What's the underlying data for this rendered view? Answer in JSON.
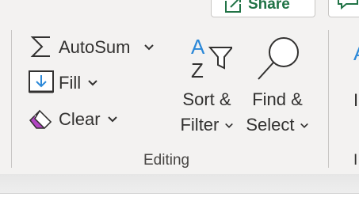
{
  "top": {
    "share_label": "Share"
  },
  "editing_group": {
    "label": "Editing",
    "autosum": {
      "label": "AutoSum",
      "icon": "sigma-icon"
    },
    "fill": {
      "label": "Fill",
      "icon": "fill-down-icon"
    },
    "clear": {
      "label": "Clear",
      "icon": "eraser-icon"
    },
    "sort_filter": {
      "line1": "Sort &",
      "line2": "Filter",
      "icon": "sort-filter-icon"
    },
    "find_select": {
      "line1": "Find &",
      "line2": "Select",
      "icon": "magnifier-icon"
    }
  },
  "next_group": {
    "partial_label_top": "I",
    "partial_label_bottom": "I"
  },
  "colors": {
    "ribbon_bg": "#f3f2f1",
    "accent_blue": "#2b88d8",
    "accent_green": "#217346",
    "eraser_purple": "#b146c2",
    "text": "#323130"
  }
}
